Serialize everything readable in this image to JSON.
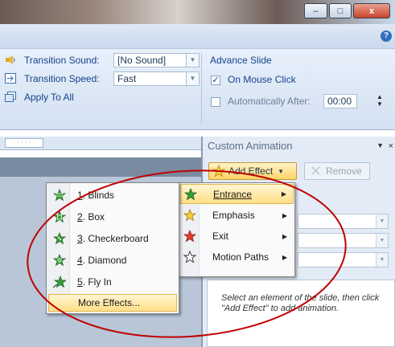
{
  "window": {
    "minimize": "–",
    "maximize": "□",
    "close": "x",
    "help": "?"
  },
  "ribbon": {
    "transition_sound_label": "Transition Sound:",
    "transition_sound_value": "[No Sound]",
    "transition_speed_label": "Transition Speed:",
    "transition_speed_value": "Fast",
    "apply_to_all": "Apply To All",
    "advance_slide_title": "Advance Slide",
    "on_mouse_click": "On Mouse Click",
    "on_mouse_click_checked": true,
    "automatically_after": "Automatically After:",
    "automatically_after_checked": false,
    "time_value": "00:00"
  },
  "ruler": {
    "mark": "· · · ·"
  },
  "pane": {
    "title": "Custom Animation",
    "add_effect": "Add Effect",
    "remove": "Remove",
    "hint": "Select an element of the slide, then click \"Add Effect\" to add animation."
  },
  "menu_main": [
    {
      "label": "Entrance",
      "icon": "entrance-star-icon",
      "highlighted": true
    },
    {
      "label": "Emphasis",
      "icon": "emphasis-star-icon",
      "highlighted": false
    },
    {
      "label": "Exit",
      "icon": "exit-star-icon",
      "highlighted": false
    },
    {
      "label": "Motion Paths",
      "icon": "motion-path-star-icon",
      "highlighted": false
    }
  ],
  "menu_sub": [
    {
      "num": "1",
      "label": ". Blinds",
      "icon": "blinds-icon"
    },
    {
      "num": "2",
      "label": ". Box",
      "icon": "box-icon"
    },
    {
      "num": "3",
      "label": ". Checkerboard",
      "icon": "checkerboard-icon"
    },
    {
      "num": "4",
      "label": ". Diamond",
      "icon": "diamond-icon"
    },
    {
      "num": "5",
      "label": ". Fly In",
      "icon": "fly-in-icon"
    }
  ],
  "more_effects": "More Effects...",
  "colors": {
    "annotation": "#c00000",
    "highlight": "#ffdf87",
    "star_green": "#3a9d3a"
  }
}
